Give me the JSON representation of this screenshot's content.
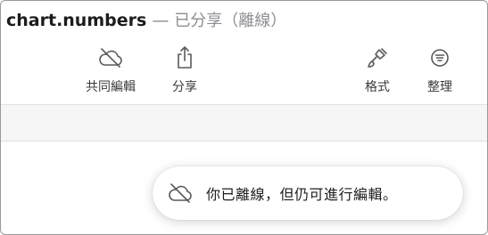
{
  "window": {
    "document_name": "chart.numbers",
    "separator": "—",
    "status": "已分享（離線）"
  },
  "toolbar": {
    "collaborate": {
      "label": "共同編輯",
      "icon": "cloud-offline-icon"
    },
    "share": {
      "label": "分享",
      "icon": "share-icon"
    },
    "format": {
      "label": "格式",
      "icon": "paintbrush-icon"
    },
    "organize": {
      "label": "整理",
      "icon": "filter-lines-icon"
    }
  },
  "toast": {
    "icon": "cloud-offline-icon",
    "message": "你已離線，但仍可進行編輯。"
  },
  "colors": {
    "icon_gray": "#5a5a5e",
    "secondary_text": "#8e8e93"
  }
}
